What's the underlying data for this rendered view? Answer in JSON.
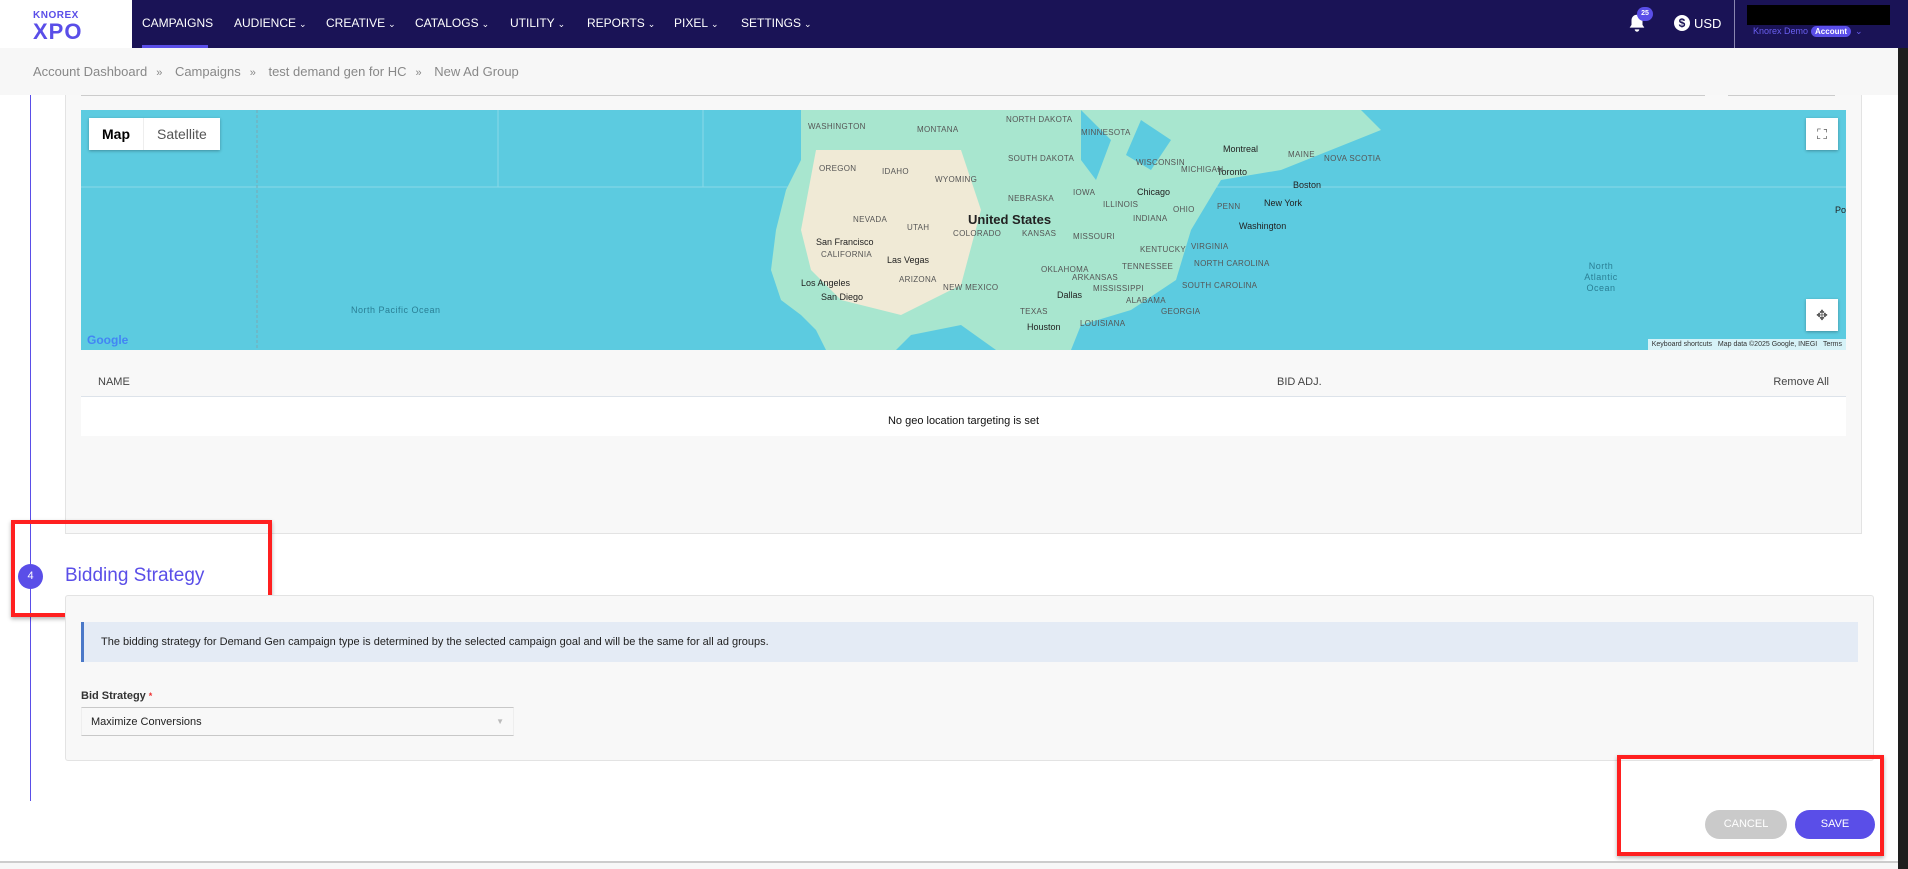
{
  "header": {
    "logo_top": "KNOREX",
    "logo_main": "XPO",
    "nav": [
      {
        "label": "CAMPAIGNS",
        "active": true
      },
      {
        "label": "AUDIENCE",
        "dropdown": true
      },
      {
        "label": "CREATIVE",
        "dropdown": true
      },
      {
        "label": "CATALOGS",
        "dropdown": true
      },
      {
        "label": "UTILITY",
        "dropdown": true
      },
      {
        "label": "REPORTS",
        "dropdown": true
      },
      {
        "label": "PIXEL",
        "dropdown": true
      },
      {
        "label": "SETTINGS",
        "dropdown": true
      }
    ],
    "notification_count": "25",
    "currency": "USD",
    "account_name": "Knorex Demo",
    "account_badge": "Account"
  },
  "breadcrumb": [
    "Account Dashboard",
    "Campaigns",
    "test demand gen for HC",
    "New Ad Group"
  ],
  "map": {
    "type_options": [
      "Map",
      "Satellite"
    ],
    "selected_type": "Map",
    "country_label": "United States",
    "ocean_pacific": "North Pacific Ocean",
    "ocean_atlantic": "North Atlantic Ocean",
    "cities": [
      "San Francisco",
      "Las Vegas",
      "Los Angeles",
      "San Diego",
      "Chicago",
      "Toronto",
      "Montreal",
      "Boston",
      "New York",
      "Washington",
      "Dallas",
      "Houston"
    ],
    "states": [
      "WASHINGTON",
      "OREGON",
      "IDAHO",
      "NEVADA",
      "UTAH",
      "CALIFORNIA",
      "ARIZONA",
      "MONTANA",
      "WYOMING",
      "COLORADO",
      "NEW MEXICO",
      "NORTH DAKOTA",
      "SOUTH DAKOTA",
      "NEBRASKA",
      "KANSAS",
      "OKLAHOMA",
      "TEXAS",
      "MINNESOTA",
      "IOWA",
      "MISSOURI",
      "ARKANSAS",
      "LOUISIANA",
      "WISCONSIN",
      "ILLINOIS",
      "MICHIGAN",
      "INDIANA",
      "OHIO",
      "KENTUCKY",
      "TENNESSEE",
      "MISSISSIPPI",
      "ALABAMA",
      "GEORGIA",
      "PENN",
      "NEW YORK",
      "VIRGINIA",
      "NORTH CAROLINA",
      "SOUTH CAROLINA",
      "MAINE",
      "NOVA SCOTIA"
    ],
    "keyboard_shortcuts": "Keyboard shortcuts",
    "map_data": "Map data ©2025 Google, INEGI",
    "terms": "Terms",
    "google": "Google",
    "edge_label": "Po"
  },
  "geo_table": {
    "columns": [
      "NAME",
      "BID ADJ.",
      "Remove All"
    ],
    "empty_message": "No geo location targeting is set"
  },
  "bidding": {
    "step_number": "4",
    "title": "Bidding Strategy",
    "info": "The bidding strategy for Demand Gen campaign type is determined by the selected campaign goal and will be the same for all ad groups.",
    "label": "Bid Strategy",
    "required_mark": "*",
    "selected": "Maximize Conversions"
  },
  "actions": {
    "cancel": "CANCEL",
    "save": "SAVE"
  },
  "colors": {
    "nav_bg": "#1a1356",
    "accent": "#5a4ee8",
    "highlight": "#ff2020",
    "ocean": "#5ccbe0"
  }
}
